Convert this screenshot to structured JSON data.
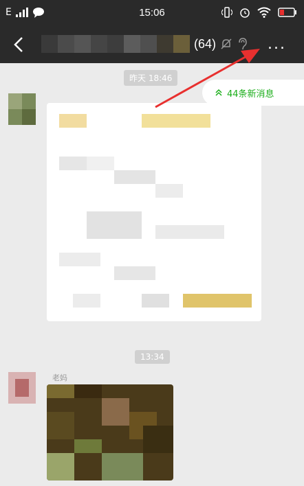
{
  "status_bar": {
    "network": "E",
    "signal_icon": "signal-bars-icon",
    "chat_icon": "speech-bubble-icon",
    "time": "15:06",
    "vibrate_icon": "vibrate-icon",
    "alarm_icon": "alarm-icon",
    "wifi_icon": "wifi-icon",
    "battery_icon": "battery-icon"
  },
  "nav": {
    "back_icon": "chevron-left-icon",
    "member_count": "(64)",
    "mute_icon": "bell-muted-icon",
    "earpiece_icon": "ear-icon",
    "more_label": "..."
  },
  "chat": {
    "timestamp_1": "昨天 18:46",
    "new_messages": "44条新消息",
    "new_messages_icon": "double-chevron-up-icon",
    "timestamp_2": "13:34",
    "sender_2": "老妈"
  },
  "colors": {
    "header_bg": "#2a2a2a",
    "chat_bg": "#ebebeb",
    "accent_green": "#1aad19",
    "annotation_red": "#e8302f"
  }
}
